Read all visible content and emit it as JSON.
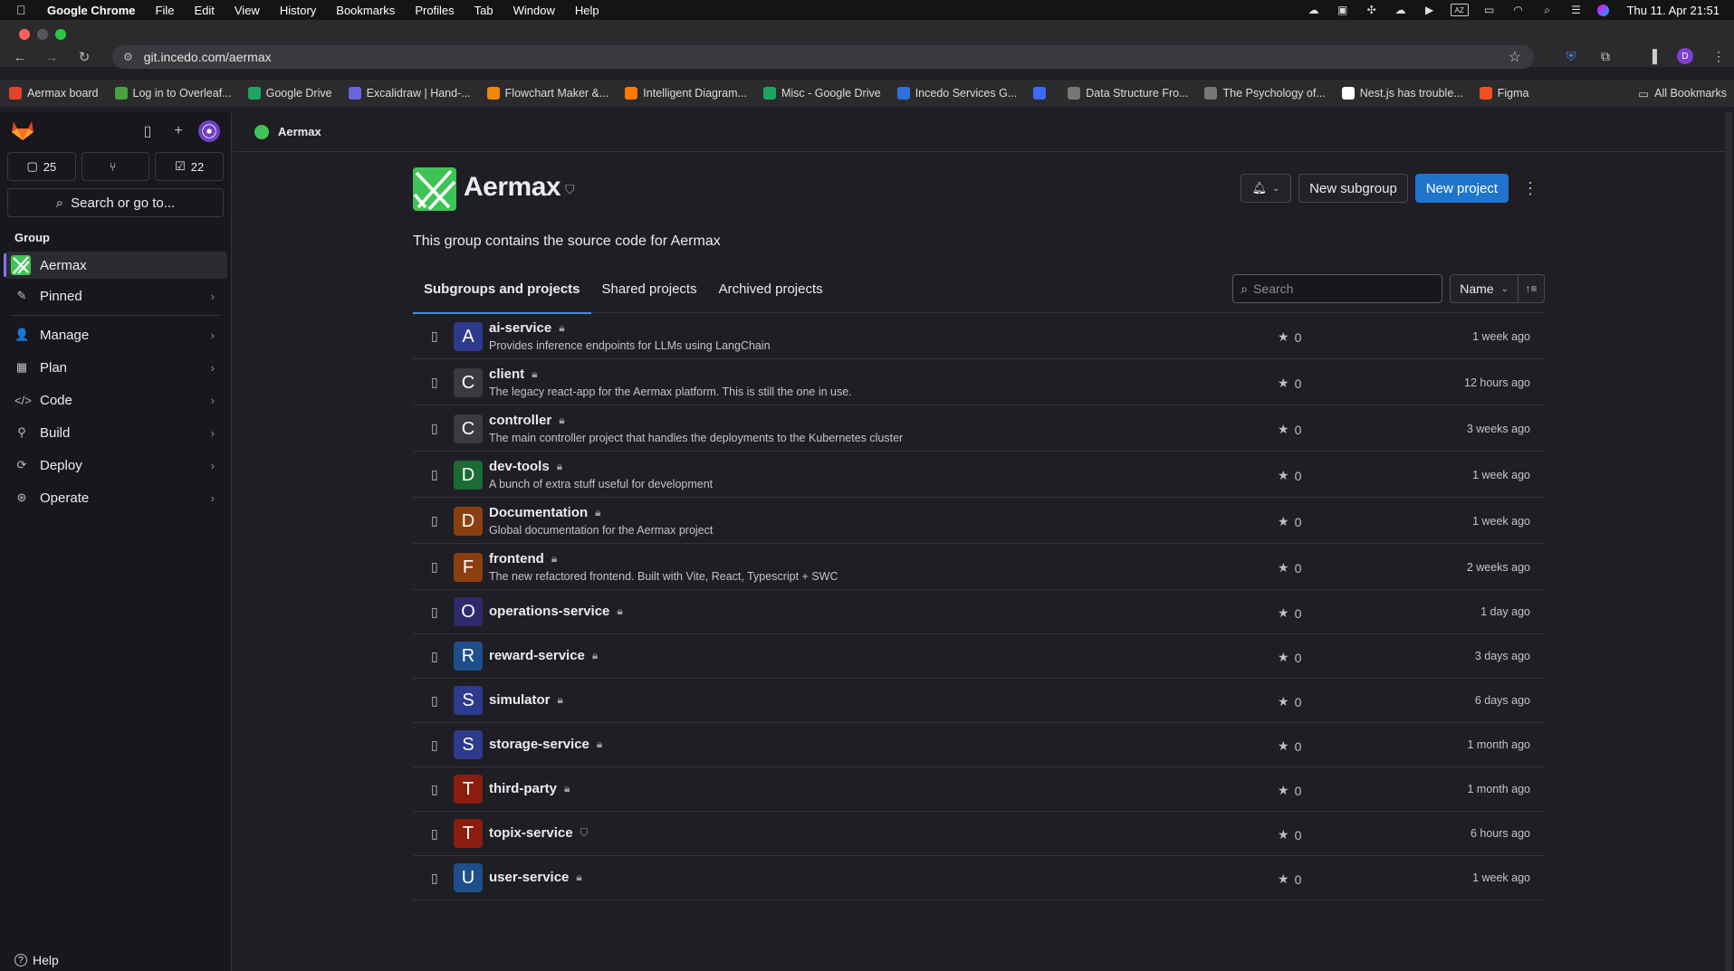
{
  "os_menubar": {
    "app": "Google Chrome",
    "menus": [
      "File",
      "Edit",
      "View",
      "History",
      "Bookmarks",
      "Profiles",
      "Tab",
      "Window",
      "Help"
    ],
    "clock": "Thu 11. Apr  21:51"
  },
  "browser": {
    "url": "git.incedo.com/aermax",
    "bookmarks": [
      {
        "label": "Aermax board",
        "color": "#e24329",
        "icon": "gitlab-icon"
      },
      {
        "label": "Log in to Overleaf...",
        "color": "#47a141",
        "icon": "overleaf-icon"
      },
      {
        "label": "Google Drive",
        "color": "#1fa463",
        "icon": "drive-icon"
      },
      {
        "label": "Excalidraw | Hand-...",
        "color": "#6965db",
        "icon": "excalidraw-icon"
      },
      {
        "label": "Flowchart Maker &...",
        "color": "#f08705",
        "icon": "drawio-icon"
      },
      {
        "label": "Intelligent Diagram...",
        "color": "#ff7a00",
        "icon": "diagram-icon"
      },
      {
        "label": "Misc - Google Drive",
        "color": "#1fa463",
        "icon": "drive-icon"
      },
      {
        "label": "Incedo Services G...",
        "color": "#2f6fde",
        "icon": "calendar-icon"
      },
      {
        "label": "",
        "color": "#3b6cff",
        "icon": "c-icon"
      },
      {
        "label": "Data Structure Fro...",
        "color": "#777",
        "icon": "globe-icon"
      },
      {
        "label": "The Psychology of...",
        "color": "#777",
        "icon": "globe-icon"
      },
      {
        "label": "Nest.js has trouble...",
        "color": "#fff",
        "icon": "github-icon"
      },
      {
        "label": "Figma",
        "color": "#f24e1e",
        "icon": "figma-icon"
      }
    ],
    "all_bookmarks": "All Bookmarks"
  },
  "sidebar": {
    "counters": {
      "issues": "25",
      "merge_requests": "",
      "todos": "22"
    },
    "search_label": "Search or go to...",
    "section": "Group",
    "group_name": "Aermax",
    "items": [
      "Pinned",
      "Manage",
      "Plan",
      "Code",
      "Build",
      "Deploy",
      "Operate"
    ],
    "help": "Help"
  },
  "breadcrumb": {
    "label": "Aermax"
  },
  "group": {
    "title": "Aermax",
    "description": "This group contains the source code for Aermax",
    "new_subgroup": "New subgroup",
    "new_project": "New project"
  },
  "tabs": [
    "Subgroups and projects",
    "Shared projects",
    "Archived projects"
  ],
  "filter": {
    "search_placeholder": "Search",
    "sort_label": "Name"
  },
  "colors": {
    "primary": "#1f75cb",
    "tab_underline": "#428fdc",
    "group_accent": "#3ec456"
  },
  "projects": [
    {
      "letter": "A",
      "name": "ai-service",
      "desc": "Provides inference endpoints for LLMs using LangChain",
      "stars": "0",
      "updated": "1 week ago",
      "color": "#2e3a8c",
      "visibility": "lock"
    },
    {
      "letter": "C",
      "name": "client",
      "desc": "The legacy react-app for the Aermax platform. This is still the one in use.",
      "stars": "0",
      "updated": "12 hours ago",
      "color": "#3a3a40",
      "visibility": "lock"
    },
    {
      "letter": "C",
      "name": "controller",
      "desc": "The main controller project that handles the deployments to the Kubernetes cluster",
      "stars": "0",
      "updated": "3 weeks ago",
      "color": "#3a3a40",
      "visibility": "lock"
    },
    {
      "letter": "D",
      "name": "dev-tools",
      "desc": "A bunch of extra stuff useful for development",
      "stars": "0",
      "updated": "1 week ago",
      "color": "#1a6b34",
      "visibility": "lock"
    },
    {
      "letter": "D",
      "name": "Documentation",
      "desc": "Global documentation for the Aermax project",
      "stars": "0",
      "updated": "1 week ago",
      "color": "#8a3f10",
      "visibility": "lock"
    },
    {
      "letter": "F",
      "name": "frontend",
      "desc": "The new refactored frontend. Built with Vite, React, Typescript + SWC",
      "stars": "0",
      "updated": "2 weeks ago",
      "color": "#8a3f10",
      "visibility": "lock"
    },
    {
      "letter": "O",
      "name": "operations-service",
      "desc": "",
      "stars": "0",
      "updated": "1 day ago",
      "color": "#2e2a6b",
      "visibility": "lock"
    },
    {
      "letter": "R",
      "name": "reward-service",
      "desc": "",
      "stars": "0",
      "updated": "3 days ago",
      "color": "#1f4f8a",
      "visibility": "lock"
    },
    {
      "letter": "S",
      "name": "simulator",
      "desc": "",
      "stars": "0",
      "updated": "6 days ago",
      "color": "#2e3a8c",
      "visibility": "lock"
    },
    {
      "letter": "S",
      "name": "storage-service",
      "desc": "",
      "stars": "0",
      "updated": "1 month ago",
      "color": "#2e3a8c",
      "visibility": "lock"
    },
    {
      "letter": "T",
      "name": "third-party",
      "desc": "",
      "stars": "0",
      "updated": "1 month ago",
      "color": "#8a1d10",
      "visibility": "lock"
    },
    {
      "letter": "T",
      "name": "topix-service",
      "desc": "",
      "stars": "0",
      "updated": "6 hours ago",
      "color": "#8a1d10",
      "visibility": "shield"
    },
    {
      "letter": "U",
      "name": "user-service",
      "desc": "",
      "stars": "0",
      "updated": "1 week ago",
      "color": "#1f4f8a",
      "visibility": "lock"
    }
  ]
}
